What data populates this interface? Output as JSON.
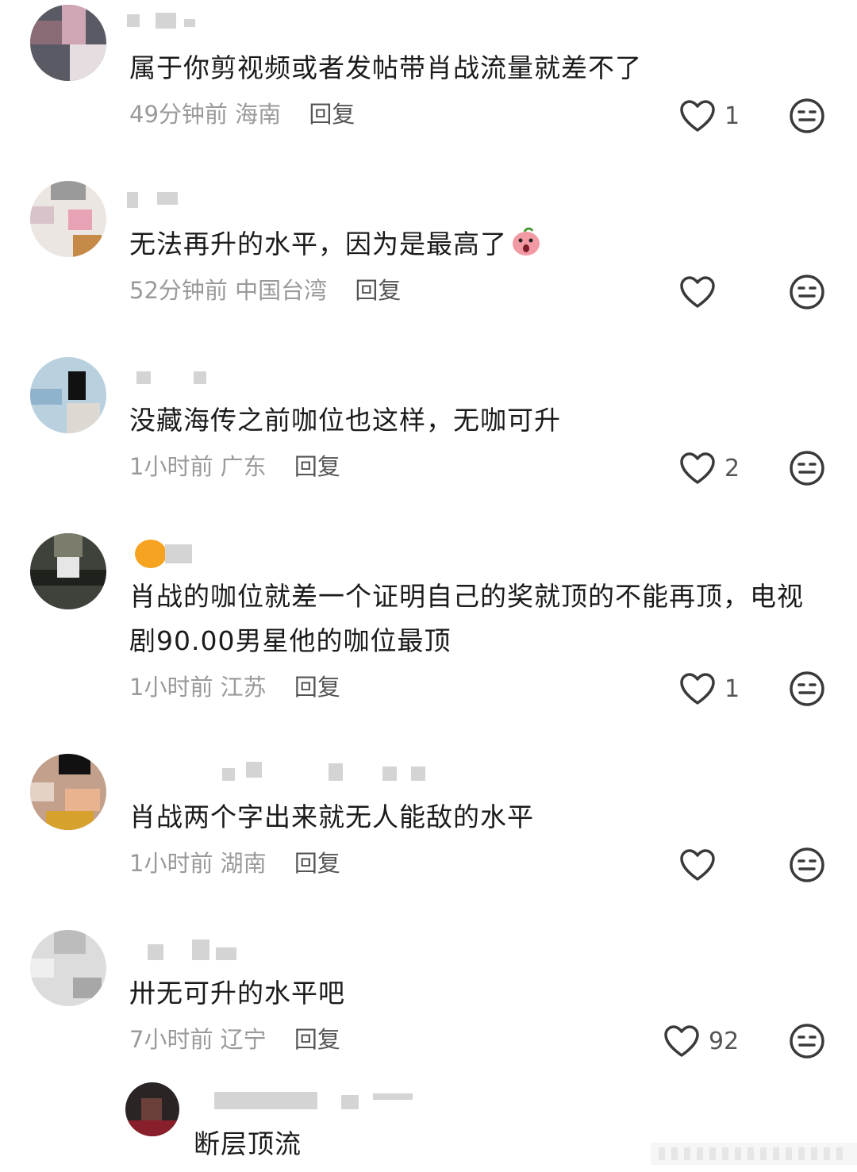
{
  "comments": [
    {
      "text": "属于你剪视频或者发帖带肖战流量就差不了",
      "time": "49分钟前",
      "location": "海南",
      "reply": "回复",
      "likes": "1"
    },
    {
      "text": "无法再升的水平，因为是最高了",
      "time": "52分钟前",
      "location": "中国台湾",
      "reply": "回复",
      "likes": ""
    },
    {
      "text": "没藏海传之前咖位也这样，无咖可升",
      "time": "1小时前",
      "location": "广东",
      "reply": "回复",
      "likes": "2"
    },
    {
      "text": "肖战的咖位就差一个证明自己的奖就顶的不能再顶，电视剧90.00男星他的咖位最顶",
      "time": "1小时前",
      "location": "江苏",
      "reply": "回复",
      "likes": "1"
    },
    {
      "text": "肖战两个字出来就无人能敌的水平",
      "time": "1小时前",
      "location": "湖南",
      "reply": "回复",
      "likes": ""
    },
    {
      "text": "卅无可升的水平吧",
      "time": "7小时前",
      "location": "辽宁",
      "reply": "回复",
      "likes": "92"
    }
  ],
  "sub_reply": {
    "text": "断层顶流"
  },
  "icons": {
    "like": "heart-outline-icon",
    "react": "neutral-face-icon",
    "emoji": "blush-emoji-icon"
  },
  "colors": {
    "text": "#1b1b1b",
    "meta": "#9a9a9a",
    "icon": "#3a3a3a"
  }
}
